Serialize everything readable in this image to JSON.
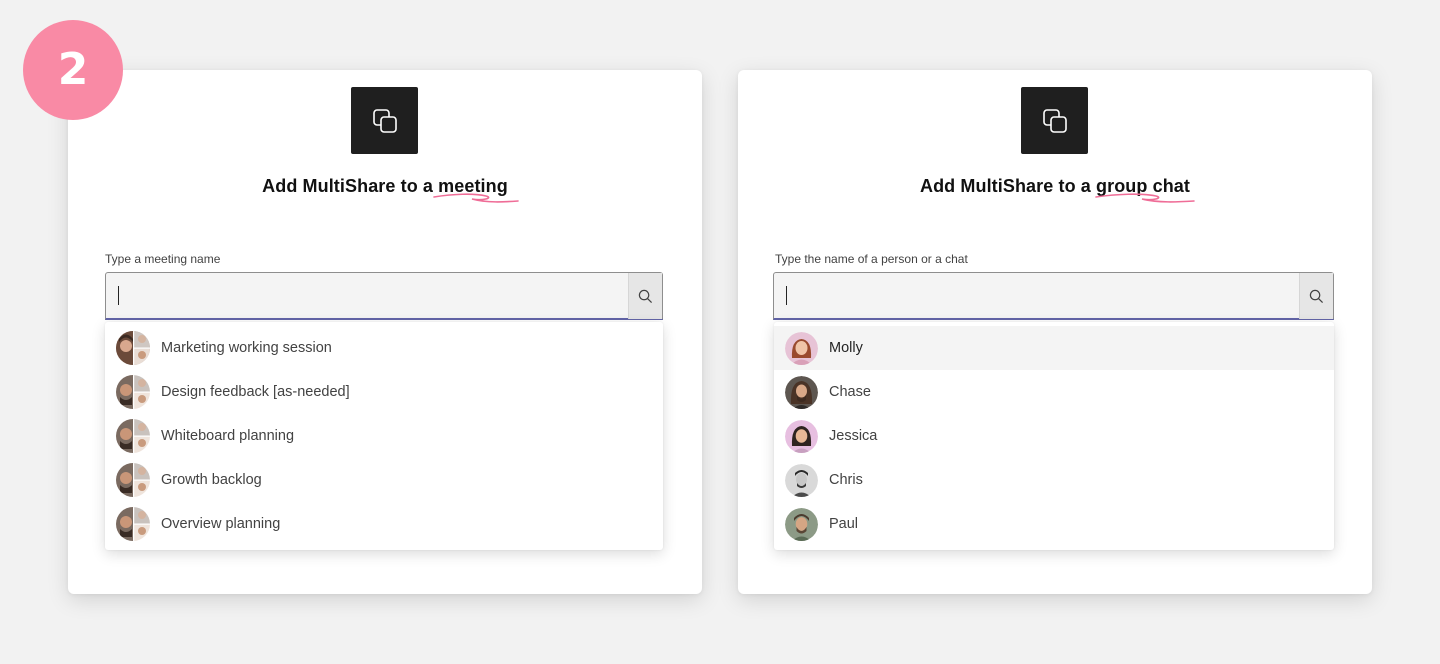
{
  "step": {
    "number": "2"
  },
  "colors": {
    "badge": "#f98aa5",
    "underline": "#ef6d97",
    "focus": "#6264a7",
    "app_icon_bg": "#1f1f1f"
  },
  "meeting_card": {
    "icon": "multishare-icon",
    "title_prefix": "Add MultiShare to a ",
    "title_emphasis": "meeting",
    "field_label": "Type a meeting name",
    "search_value": "",
    "search_icon": "search-icon",
    "items": [
      {
        "label": "Marketing working session",
        "avatar": "group-avatar"
      },
      {
        "label": "Design feedback [as-needed]",
        "avatar": "group-avatar"
      },
      {
        "label": "Whiteboard planning",
        "avatar": "group-avatar"
      },
      {
        "label": "Growth backlog",
        "avatar": "group-avatar"
      },
      {
        "label": "Overview planning",
        "avatar": "group-avatar"
      }
    ]
  },
  "chat_card": {
    "icon": "multishare-icon",
    "title_prefix": "Add MultiShare to a ",
    "title_emphasis": "group chat",
    "field_label": "Type the name of a person or a chat",
    "search_value": "",
    "search_icon": "search-icon",
    "selected_index": 0,
    "items": [
      {
        "label": "Molly",
        "avatar": "person-avatar"
      },
      {
        "label": "Chase",
        "avatar": "person-avatar"
      },
      {
        "label": "Jessica",
        "avatar": "person-avatar"
      },
      {
        "label": "Chris",
        "avatar": "person-avatar"
      },
      {
        "label": "Paul",
        "avatar": "person-avatar"
      }
    ]
  }
}
